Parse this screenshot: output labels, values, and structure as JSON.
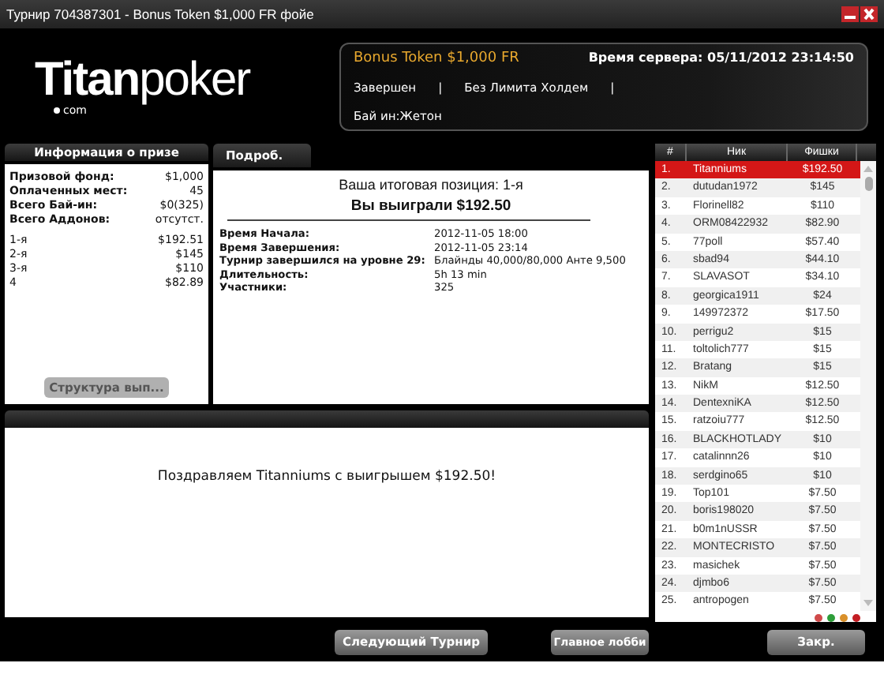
{
  "window": {
    "title": "Турнир 704387301 - Bonus Token $1,000 FR фойе"
  },
  "logo": {
    "main": "Titan",
    "rest": "poker",
    "sub": "com"
  },
  "info": {
    "name": "Bonus Token $1,000 FR",
    "server_time": "Время сервера: 05/11/2012 23:14:50",
    "status": "Завершен",
    "separator": "|",
    "game": "Без Лимита Холдем",
    "buyin": "Бай ин:Жетон"
  },
  "prize": {
    "tab": "Информация о призе",
    "summary": [
      {
        "label": "Призовой фонд:",
        "value": "$1,000"
      },
      {
        "label": "Оплаченных мест:",
        "value": "45"
      },
      {
        "label": "Всего Бай-ин:",
        "value": "$0(325)"
      },
      {
        "label": "Всего Аддонов:",
        "value": "отсутст."
      }
    ],
    "places": [
      {
        "place": "1-я",
        "amount": "$192.51"
      },
      {
        "place": "2-я",
        "amount": "$145"
      },
      {
        "place": "3-я",
        "amount": "$110"
      },
      {
        "place": "4",
        "amount": "$82.89"
      }
    ],
    "button": {
      "label": "Структура вып...",
      "disabled": true
    }
  },
  "details": {
    "tab": "Подроб.",
    "position": "Ваша итоговая позиция: 1-я",
    "won": "Вы выиграли $192.50",
    "rows": [
      {
        "label": "Время Начала:",
        "value": "2012-11-05 18:00"
      },
      {
        "label": "Время Завершения:",
        "value": "2012-11-05 23:14"
      },
      {
        "label": "Турнир завершился на уровне 29:",
        "value": "Блайнды 40,000/80,000 Анте 9,500"
      },
      {
        "label": "Длительность:",
        "value": "5h 13 min"
      },
      {
        "label": "Участники:",
        "value": "325"
      }
    ]
  },
  "message": "Поздравляем Titanniums с выигрышем $192.50!",
  "leaderboard": {
    "columns": [
      "#",
      "Ник",
      "Фишки"
    ],
    "rows": [
      {
        "rank": "1.",
        "nick": "Titanniums",
        "chips": "$192.50",
        "selected": true
      },
      {
        "rank": "2.",
        "nick": "dutudan1972",
        "chips": "$145",
        "selected": false
      },
      {
        "rank": "3.",
        "nick": "Florinell82",
        "chips": "$110",
        "selected": false
      },
      {
        "rank": "4.",
        "nick": "ORM08422932",
        "chips": "$82.90",
        "selected": false
      },
      {
        "rank": "5.",
        "nick": "77poll",
        "chips": "$57.40",
        "selected": false
      },
      {
        "rank": "6.",
        "nick": "sbad94",
        "chips": "$44.10",
        "selected": false
      },
      {
        "rank": "7.",
        "nick": "SLAVASOT",
        "chips": "$34.10",
        "selected": false
      },
      {
        "rank": "8.",
        "nick": "georgica1911",
        "chips": "$24",
        "selected": false
      },
      {
        "rank": "9.",
        "nick": "149972372",
        "chips": "$17.50",
        "selected": false
      },
      {
        "rank": "10.",
        "nick": "perrigu2",
        "chips": "$15",
        "selected": false
      },
      {
        "rank": "11.",
        "nick": "toltolich777",
        "chips": "$15",
        "selected": false
      },
      {
        "rank": "12.",
        "nick": "Bratang",
        "chips": "$15",
        "selected": false
      },
      {
        "rank": "13.",
        "nick": "NikM",
        "chips": "$12.50",
        "selected": false
      },
      {
        "rank": "14.",
        "nick": "DentexniKA",
        "chips": "$12.50",
        "selected": false
      },
      {
        "rank": "15.",
        "nick": "ratzoiu777",
        "chips": "$12.50",
        "selected": false
      },
      {
        "rank": "16.",
        "nick": "BLACKHOTLADY",
        "chips": "$10",
        "selected": false
      },
      {
        "rank": "17.",
        "nick": "catalinnn26",
        "chips": "$10",
        "selected": false
      },
      {
        "rank": "18.",
        "nick": "serdgino65",
        "chips": "$10",
        "selected": false
      },
      {
        "rank": "19.",
        "nick": "Top101",
        "chips": "$7.50",
        "selected": false
      },
      {
        "rank": "20.",
        "nick": "boris198020",
        "chips": "$7.50",
        "selected": false
      },
      {
        "rank": "21.",
        "nick": "b0m1nUSSR",
        "chips": "$7.50",
        "selected": false
      },
      {
        "rank": "22.",
        "nick": "MONTECRISTO",
        "chips": "$7.50",
        "selected": false
      },
      {
        "rank": "23.",
        "nick": "masichek",
        "chips": "$7.50",
        "selected": false
      },
      {
        "rank": "24.",
        "nick": "djmbo6",
        "chips": "$7.50",
        "selected": false
      },
      {
        "rank": "25.",
        "nick": "antropogen",
        "chips": "$7.50",
        "selected": false
      }
    ],
    "legend": [
      {
        "color": "#d04a4a"
      },
      {
        "color": "#2e9e3a"
      },
      {
        "color": "#d9902a"
      },
      {
        "color": "#c41e24"
      }
    ]
  },
  "buttons": [
    "Следующий Турнир",
    "Главное лобби",
    "Закр."
  ]
}
